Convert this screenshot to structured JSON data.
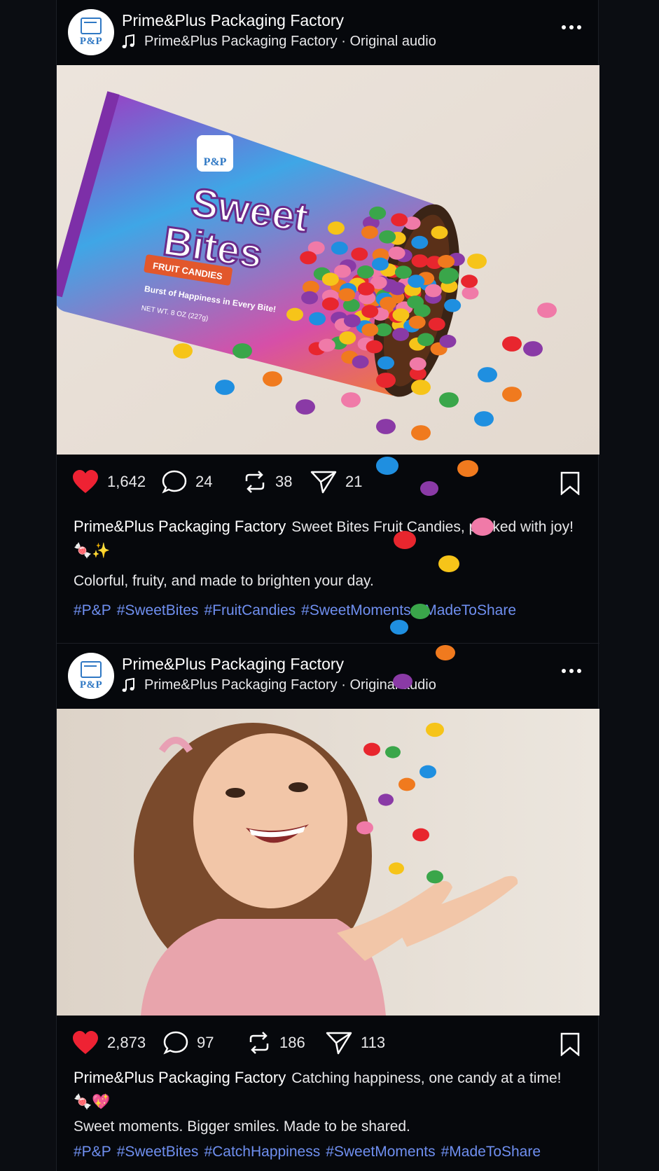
{
  "colors": {
    "background": "#0b0d12",
    "feed_background": "#06080c",
    "like_red": "#ee2233",
    "hashtag_blue": "#6f8ff0",
    "brand_blue": "#2f78c4"
  },
  "posts": [
    {
      "author": "Prime&Plus Packaging Factory",
      "avatar_text": "P&P",
      "audio": "Prime&Plus Packaging Factory · Original audio",
      "image": {
        "brand": "P&P",
        "product_line1": "Sweet",
        "product_line2": "Bites",
        "ribbon": "FRUIT CANDIES",
        "tagline": "Burst of Happiness in Every Bite!",
        "net_weight": "NET WT. 8 OZ (227g)"
      },
      "likes": "1,642",
      "comments": "24",
      "reposts": "38",
      "shares": "21",
      "caption": "Sweet Bites Fruit Candies, packed with joy! 🍬✨",
      "sub_caption": "Colorful, fruity, and made to brighten your day.",
      "hashtags": [
        "#P&P",
        "#SweetBites",
        "#FruitCandies",
        "#SweetMoments",
        "#MadeToShare"
      ]
    },
    {
      "author": "Prime&Plus Packaging Factory",
      "avatar_text": "P&P",
      "audio": "Prime&Plus Packaging Factory · Original audio",
      "likes": "2,873",
      "comments": "97",
      "reposts": "186",
      "shares": "113",
      "caption": "Catching happiness, one candy at a time! 🍬💖",
      "sub_caption": "Sweet moments. Bigger smiles. Made to be shared.",
      "hashtags": [
        "#P&P",
        "#SweetBites",
        "#CatchHappiness",
        "#SweetMoments",
        "#MadeToShare"
      ]
    }
  ]
}
